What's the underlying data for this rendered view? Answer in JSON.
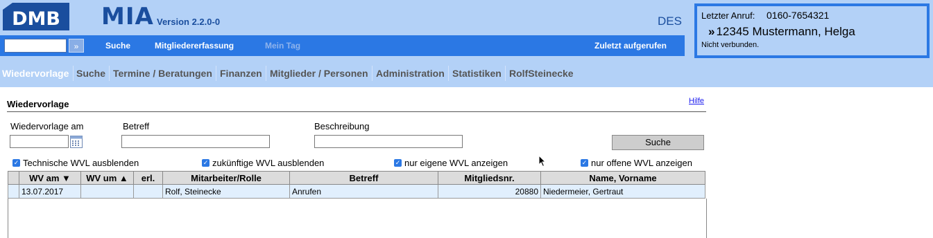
{
  "header": {
    "logo_text": "DMB",
    "app_name": "MIA",
    "version": "Version 2.2.0-0",
    "locale": "DES"
  },
  "nav": {
    "quick_search_value": "",
    "quick_go": "»",
    "links": [
      "Suche",
      "Mitgliedererfassung",
      "Mein Tag",
      "Zuletzt aufgerufen"
    ]
  },
  "call": {
    "label": "Letzter Anruf:",
    "number": "0160-7654321",
    "arrow": "»",
    "caller": "12345 Mustermann, Helga",
    "status": "Nicht verbunden."
  },
  "menu": {
    "items": [
      "Wiedervorlage",
      "Suche",
      "Termine / Beratungen",
      "Finanzen",
      "Mitglieder / Personen",
      "Administration",
      "Statistiken",
      "RolfSteinecke"
    ],
    "active": "Wiedervorlage"
  },
  "section": {
    "title": "Wiedervorlage",
    "help": "Hilfe"
  },
  "filters": {
    "date_label": "Wiedervorlage am",
    "date_value": "",
    "subject_label": "Betreff",
    "subject_value": "",
    "description_label": "Beschreibung",
    "description_value": "",
    "search_button": "Suche"
  },
  "checkboxes": [
    {
      "label": "Technische WVL ausblenden",
      "checked": true
    },
    {
      "label": "zukünftige WVL ausblenden",
      "checked": true
    },
    {
      "label": "nur eigene WVL anzeigen",
      "checked": true
    },
    {
      "label": "nur offene WVL anzeigen",
      "checked": true
    }
  ],
  "table": {
    "columns": [
      "",
      "WV am ▼",
      "WV um ▲",
      "erl.",
      "Mitarbeiter/Rolle",
      "Betreff",
      "Mitgliedsnr.",
      "Name, Vorname"
    ],
    "rows": [
      [
        "",
        "13.07.2017",
        "",
        "",
        "Rolf, Steinecke",
        "Anrufen",
        "20880",
        "Niedermeier, Gertraut"
      ]
    ]
  },
  "colors": {
    "header_bg": "#b3d1f7",
    "nav_bg": "#2b78e4",
    "brand_text": "#1a4e9e",
    "row_bg": "#e1effd"
  },
  "icons": {
    "calendar": "calendar-icon",
    "checkbox": "checkmark-icon",
    "cursor": "mouse-pointer-icon"
  }
}
